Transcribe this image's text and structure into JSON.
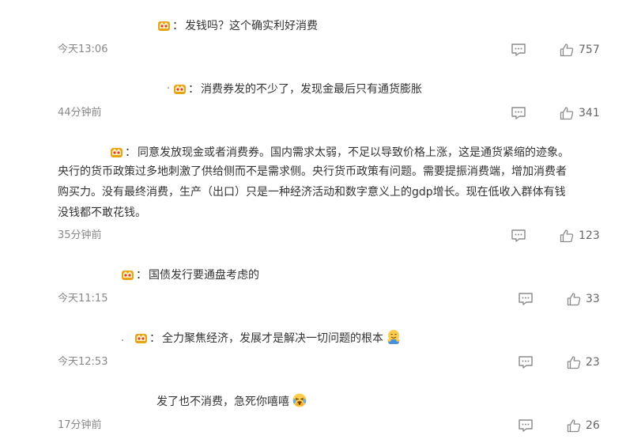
{
  "comments": [
    {
      "text": "发钱吗？这个确实利好消费",
      "time": "今天13:06",
      "likes": "757"
    },
    {
      "text": "消费券发的不少了，发现金最后只有通货膨胀",
      "time": "44分钟前",
      "likes": "341"
    },
    {
      "lines": [
        "同意发放现金或者消费券。国内需求太弱，不足以导致价格上涨，这是通货紧缩的迹象。",
        "央行的货币政策过多地刺激了供给侧而不是需求侧。央行货币政策有问题。需要提振消费端，增加消费者",
        "购买力。没有最终消费，生产（出口）只是一种经济活动和数字意义上的gdp增长。现在低收入群体有钱",
        "没钱都不敢花钱。"
      ],
      "time": "35分钟前",
      "likes": "123"
    },
    {
      "text": "国债发行要通盘考虑的",
      "time": "今天11:15",
      "likes": "33"
    },
    {
      "text": "全力聚焦经济，发展才是解决一切问题的根本",
      "emoji": "hug-emoji",
      "time": "今天12:53",
      "likes": "23"
    },
    {
      "text": "发了也不消费，急死你嘻嘻",
      "emoji": "laugh-cry-emoji",
      "time": "17分钟前",
      "likes": "26"
    }
  ],
  "separator": "：",
  "icons": {
    "badge": "crown-badge-icon",
    "comment": "comment-icon",
    "like": "thumbs-up-icon"
  },
  "colors": {
    "badge": "#e8a317",
    "badge_accent": "#d8402e",
    "text": "#333333",
    "meta": "#888888",
    "icon": "#8a8a8a"
  }
}
